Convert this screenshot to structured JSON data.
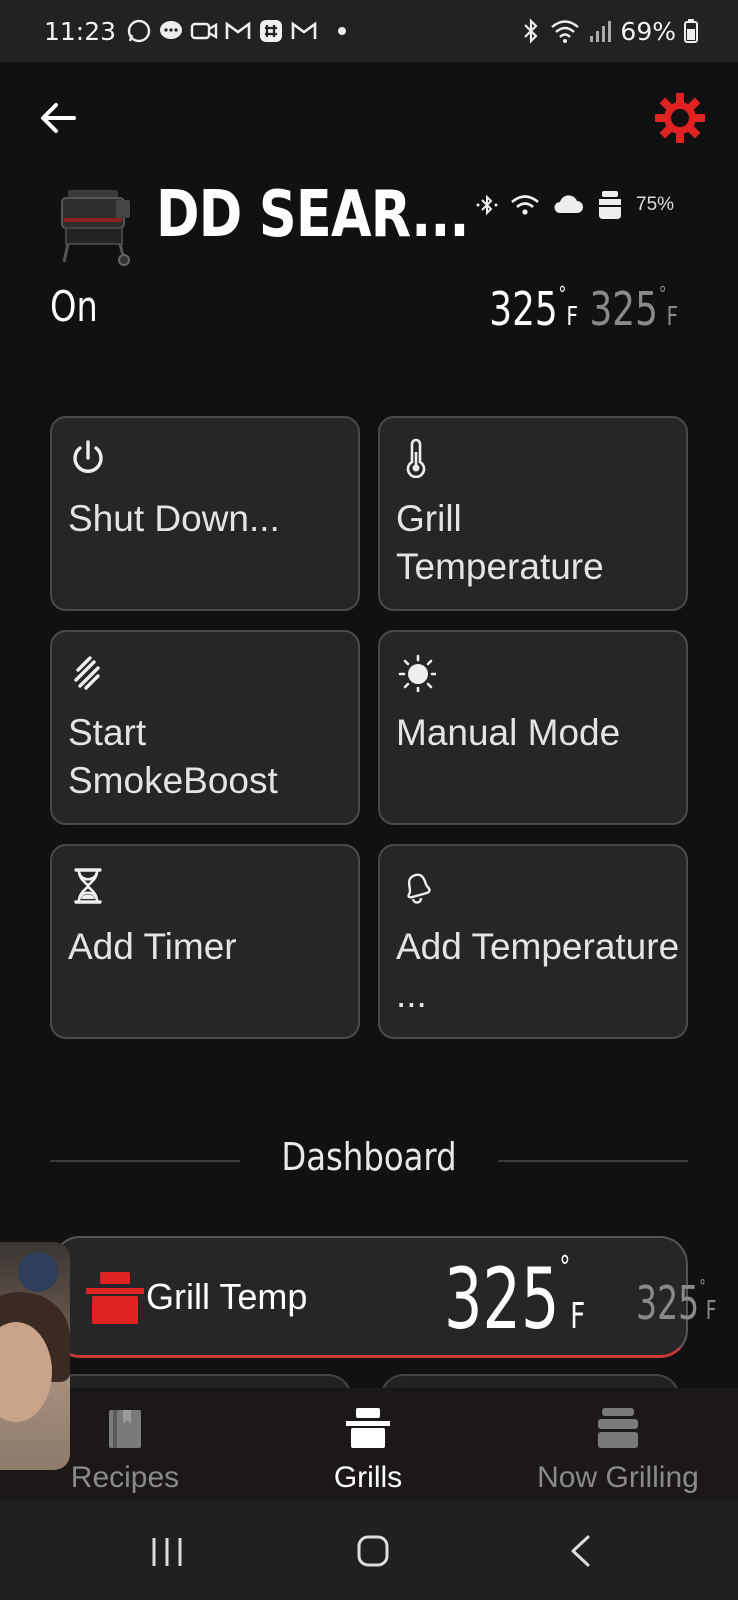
{
  "status_bar": {
    "time": "11:23",
    "battery": "69%"
  },
  "header": {
    "grill_name": "DD SEAR...",
    "pellet_level": "75%",
    "state": "On",
    "current_temp": "325",
    "set_temp": "325",
    "temp_unit": "F",
    "degree_symbol": "°",
    "accent_color": "#e02222"
  },
  "actions": [
    {
      "label": "Shut Down...",
      "icon": "power-icon"
    },
    {
      "label": "Grill Temperature",
      "icon": "thermometer-icon"
    },
    {
      "label": "Start SmokeBoost",
      "icon": "smoke-icon"
    },
    {
      "label": "Manual Mode",
      "icon": "sun-icon"
    },
    {
      "label": "Add Timer",
      "icon": "hourglass-icon"
    },
    {
      "label": "Add Temperature ...",
      "icon": "bell-icon"
    }
  ],
  "dashboard": {
    "title": "Dashboard",
    "grill_temp": {
      "label": "Grill Temp",
      "current": "325",
      "set": "325",
      "unit": "F"
    }
  },
  "bottom_nav": [
    {
      "label": "Recipes",
      "active": false
    },
    {
      "label": "Grills",
      "active": true
    },
    {
      "label": "Now Grilling",
      "active": false
    }
  ]
}
